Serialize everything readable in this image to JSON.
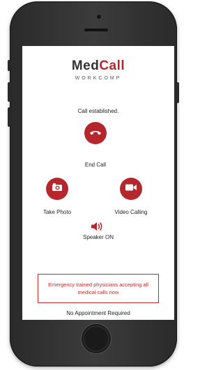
{
  "app": {
    "logo_med": "Med",
    "logo_call": "Call",
    "logo_sub": "WORKCOMP"
  },
  "status_text": "Call established.",
  "actions": {
    "end_call": {
      "label": "End Call",
      "icon": "phone-hangup-icon"
    },
    "take_photo": {
      "label": "Take Photo",
      "icon": "camera-icon"
    },
    "video_calling": {
      "label": "Video Calling",
      "icon": "video-camera-icon"
    },
    "speaker": {
      "label": "Speaker ON",
      "icon": "speaker-icon"
    }
  },
  "notice": {
    "text": "Emergency trained physicians accepting all medical calls now"
  },
  "footer_text": "No Appointment Required",
  "colors": {
    "brand_red": "#b3272d",
    "notice_red": "#c62828"
  }
}
